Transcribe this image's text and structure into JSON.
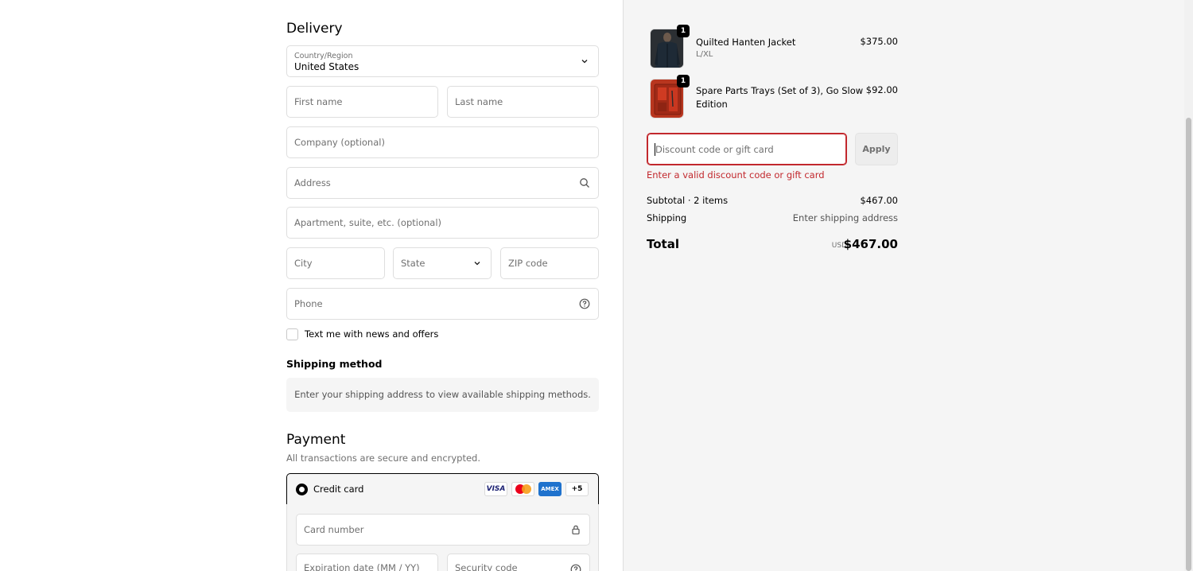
{
  "delivery": {
    "title": "Delivery",
    "country_label": "Country/Region",
    "country_value": "United States",
    "first_name_placeholder": "First name",
    "last_name_placeholder": "Last name",
    "company_placeholder": "Company (optional)",
    "address_placeholder": "Address",
    "apartment_placeholder": "Apartment, suite, etc. (optional)",
    "city_placeholder": "City",
    "state_placeholder": "State",
    "zip_placeholder": "ZIP code",
    "phone_placeholder": "Phone",
    "sms_optin_label": "Text me with news and offers"
  },
  "shipping": {
    "title": "Shipping method",
    "message": "Enter your shipping address to view available shipping methods."
  },
  "payment": {
    "title": "Payment",
    "subtitle": "All transactions are secure and encrypted.",
    "method_label": "Credit card",
    "card_logos": [
      "VISA",
      "mastercard",
      "AMEX",
      "+5"
    ],
    "card_number_placeholder": "Card number",
    "expiry_placeholder": "Expiration date (MM / YY)",
    "security_placeholder": "Security code"
  },
  "cart": {
    "items": [
      {
        "name": "Quilted Hanten Jacket",
        "variant": "L/XL",
        "price": "$375.00",
        "qty": "1"
      },
      {
        "name_line1": "Spare Parts Trays (Set of 3), Go Slow",
        "name_line2": "Edition",
        "price": "$92.00",
        "qty": "1"
      }
    ],
    "discount_placeholder": "Discount code or gift card",
    "apply_label": "Apply",
    "discount_error": "Enter a valid discount code or gift card",
    "subtotal_label": "Subtotal · 2 items",
    "subtotal_value": "$467.00",
    "shipping_label": "Shipping",
    "shipping_value": "Enter shipping address",
    "total_label": "Total",
    "total_currency": "USD",
    "total_value": "$467.00"
  },
  "colors": {
    "error": "#c2282d",
    "panel_bg": "#f5f5f5",
    "border": "#dedede"
  }
}
